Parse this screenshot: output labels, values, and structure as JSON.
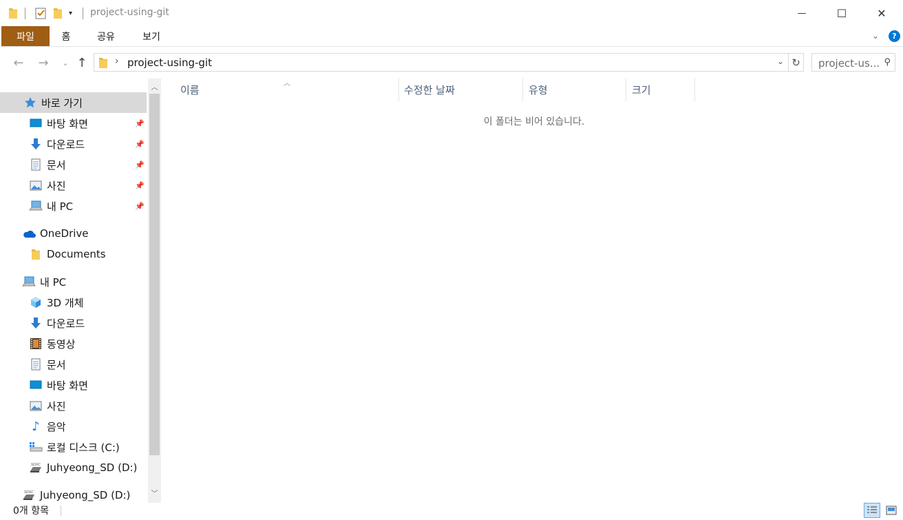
{
  "window": {
    "title": "project-using-git",
    "controls": {
      "minimize": "—",
      "maximize": "☐",
      "close": "✕"
    }
  },
  "ribbon": {
    "tabs": [
      {
        "label": "파일"
      },
      {
        "label": "홈"
      },
      {
        "label": "공유"
      },
      {
        "label": "보기"
      }
    ]
  },
  "address": {
    "path": "project-using-git",
    "search_placeholder": "project-us..."
  },
  "sidebar": {
    "quick_access": {
      "label": "바로 가기"
    },
    "pinned": [
      {
        "label": "바탕 화면",
        "icon": "desktop-icon"
      },
      {
        "label": "다운로드",
        "icon": "download-icon"
      },
      {
        "label": "문서",
        "icon": "document-icon"
      },
      {
        "label": "사진",
        "icon": "picture-icon"
      },
      {
        "label": "내 PC",
        "icon": "pc-icon"
      }
    ],
    "onedrive": {
      "label": "OneDrive"
    },
    "onedrive_items": [
      {
        "label": "Documents",
        "icon": "folder-icon"
      }
    ],
    "this_pc": {
      "label": "내 PC"
    },
    "pc_items": [
      {
        "label": "3D 개체",
        "icon": "cube-icon"
      },
      {
        "label": "다운로드",
        "icon": "download-icon"
      },
      {
        "label": "동영상",
        "icon": "video-icon"
      },
      {
        "label": "문서",
        "icon": "document-icon"
      },
      {
        "label": "바탕 화면",
        "icon": "desktop-icon"
      },
      {
        "label": "사진",
        "icon": "picture-icon"
      },
      {
        "label": "음악",
        "icon": "music-icon"
      },
      {
        "label": "로컬 디스크 (C:)",
        "icon": "disk-icon"
      },
      {
        "label": "Juhyeong_SD (D:)",
        "icon": "sd-card-icon"
      }
    ],
    "sd_root": {
      "label": "Juhyeong_SD (D:)"
    }
  },
  "content": {
    "columns": [
      {
        "label": "이름"
      },
      {
        "label": "수정한 날짜"
      },
      {
        "label": "유형"
      },
      {
        "label": "크기"
      }
    ],
    "empty_message": "이 폴더는 비어 있습니다."
  },
  "status": {
    "item_count": "0개 항목"
  },
  "colors": {
    "file_tab": "#a05d14",
    "selected": "#d9d9d9",
    "accent": "#0078d7",
    "header_text": "#4c607a"
  }
}
